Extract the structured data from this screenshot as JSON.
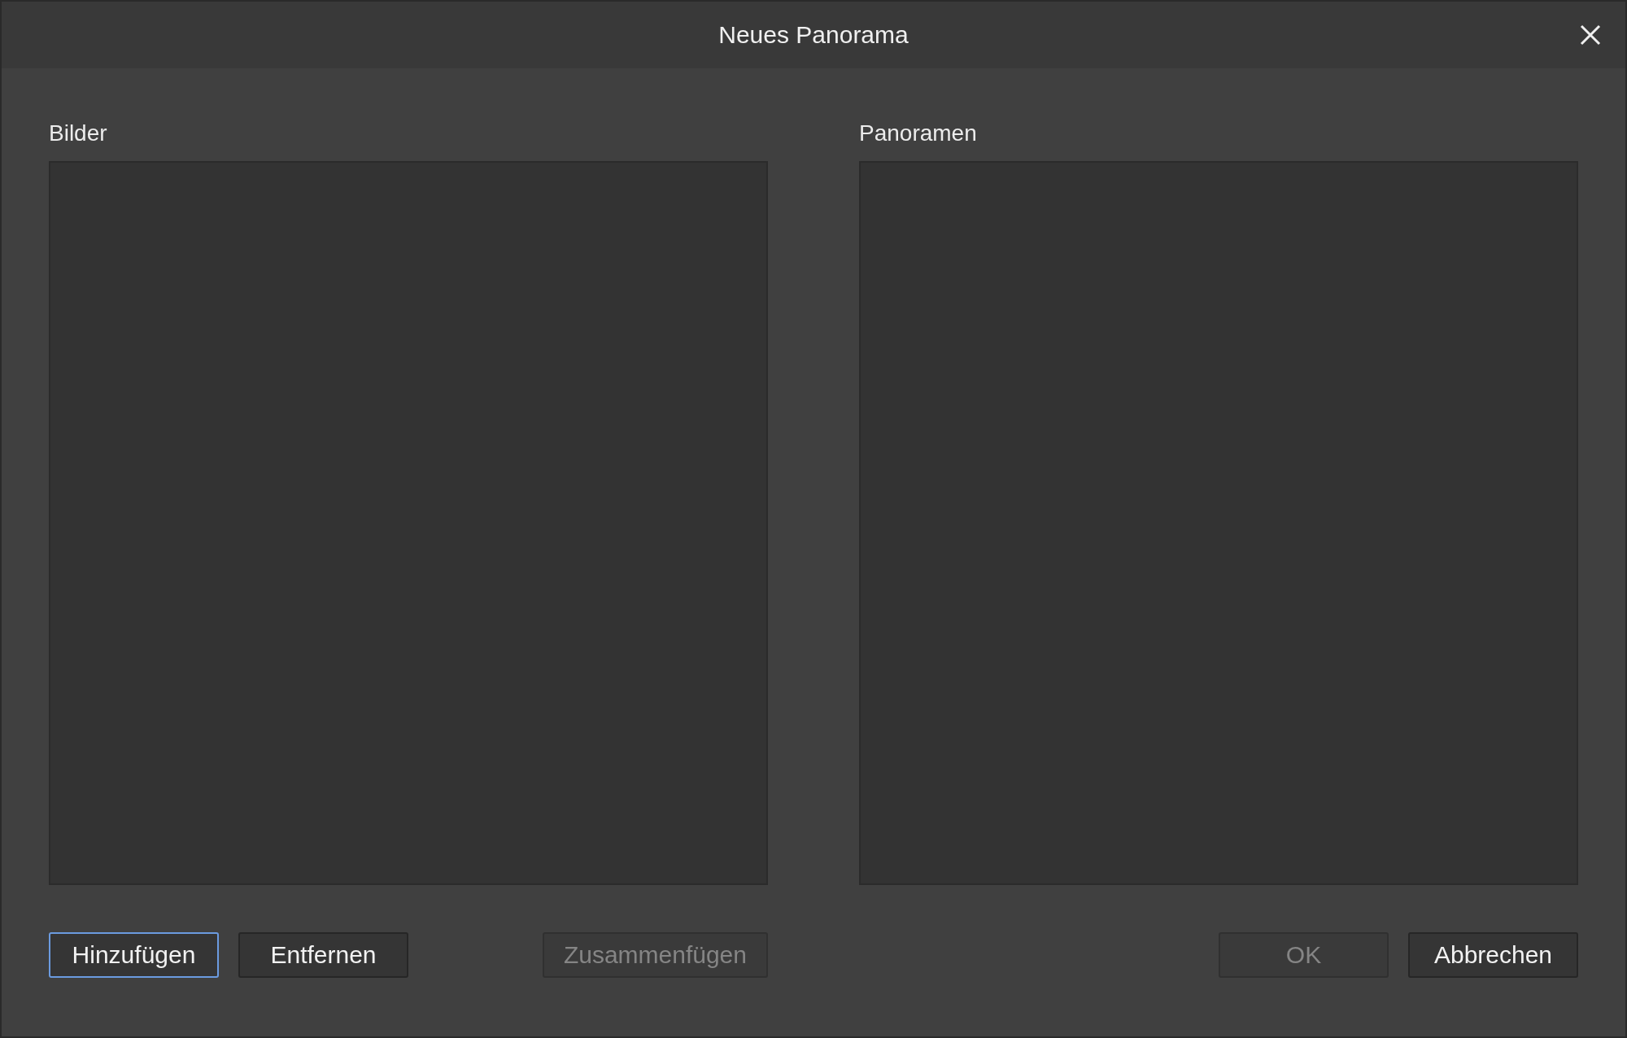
{
  "window": {
    "title": "Neues Panorama"
  },
  "panels": [
    {
      "label": "Bilder"
    },
    {
      "label": "Panoramen"
    }
  ],
  "buttons": [
    {
      "label": "Hinzufügen",
      "disabled": false,
      "focused": true
    },
    {
      "label": "Entfernen",
      "disabled": false,
      "focused": false
    },
    {
      "label": "Zusammenfügen",
      "disabled": true,
      "focused": false
    },
    {
      "label": "OK",
      "disabled": true,
      "focused": false
    },
    {
      "label": "Abbrechen",
      "disabled": false,
      "focused": false
    }
  ]
}
